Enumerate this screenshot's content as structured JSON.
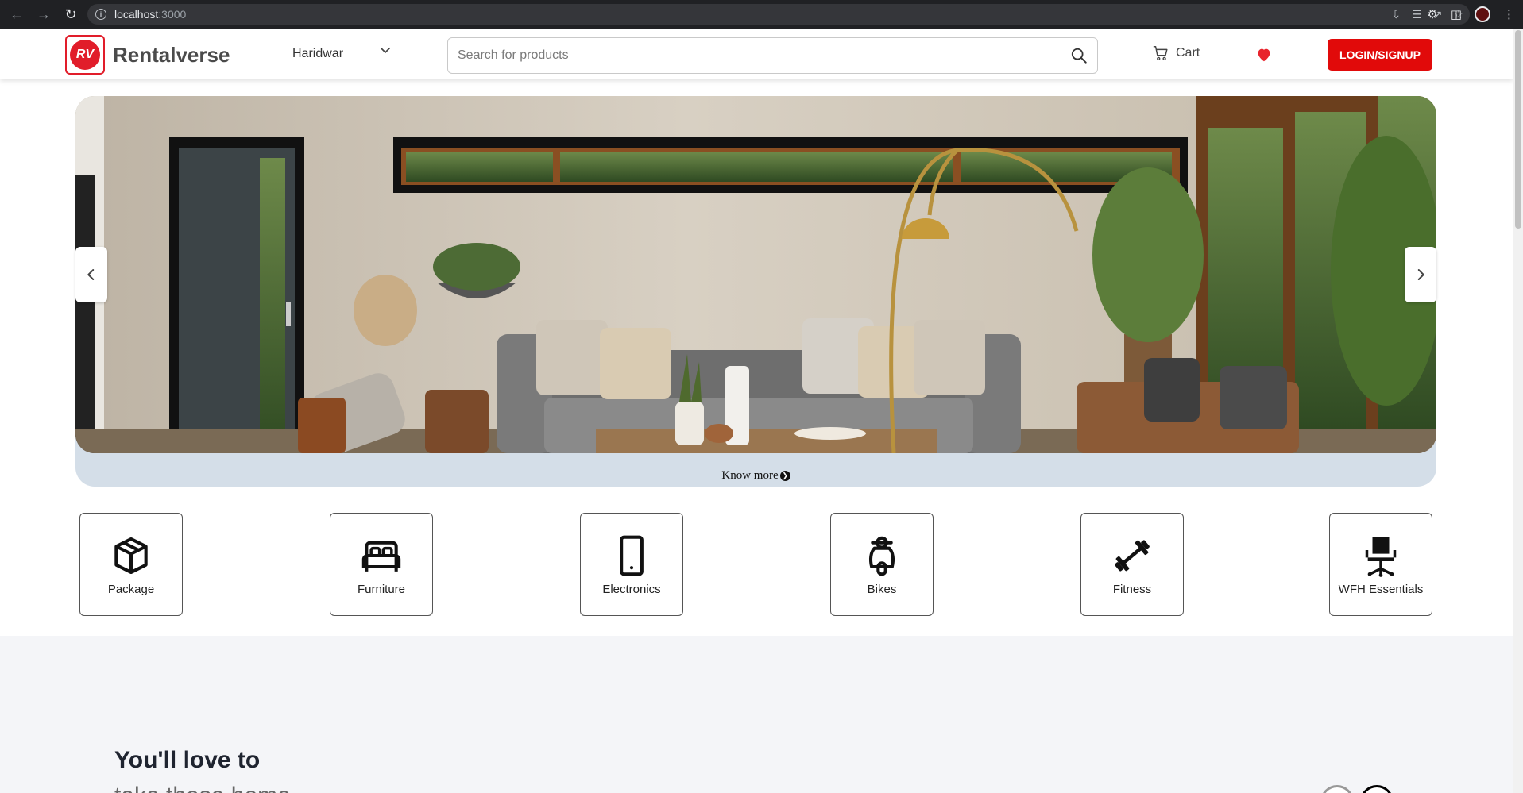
{
  "browser": {
    "url_host": "localhost",
    "url_port": ":3000",
    "icons": [
      "back-icon",
      "forward-icon",
      "reload-icon",
      "info-icon",
      "install-icon",
      "translate-icon",
      "share-icon",
      "star-icon",
      "extensions-icon",
      "sidebar-icon",
      "profile-icon",
      "menu-icon"
    ]
  },
  "header": {
    "logo_text": "RV",
    "brand": "Rentalverse",
    "city": "Haridwar",
    "search_placeholder": "Search for products",
    "cart_label": "Cart",
    "login_label": "LOGIN/SIGNUP",
    "colors": {
      "accent": "#e10a0a",
      "brand_text": "#4b4b4b"
    }
  },
  "hero": {
    "know_more": "Know more",
    "band_color": "#d4dee8"
  },
  "categories": [
    {
      "label": "Package",
      "icon": "box-icon"
    },
    {
      "label": "Furniture",
      "icon": "bed-icon"
    },
    {
      "label": "Electronics",
      "icon": "phone-icon"
    },
    {
      "label": "Bikes",
      "icon": "scooter-icon"
    },
    {
      "label": "Fitness",
      "icon": "dumbbell-icon"
    },
    {
      "label": "WFH Essentials",
      "icon": "office-chair-icon"
    }
  ],
  "love_section": {
    "title": "You'll love to",
    "subtitle": "take these home"
  }
}
